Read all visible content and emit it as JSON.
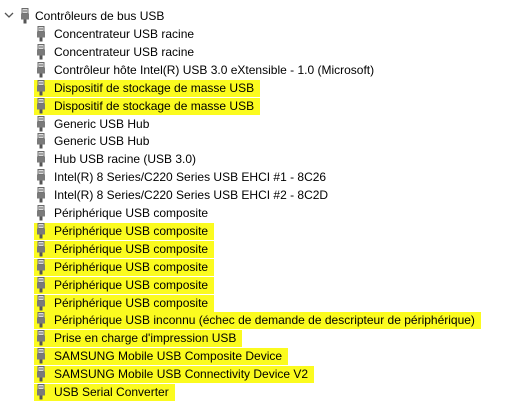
{
  "tree": {
    "category": {
      "label": "Contrôleurs de bus USB",
      "expanded": true,
      "icon": "usb-connector-icon"
    },
    "highlight_color": "#fbfb1f",
    "items": [
      {
        "label": "Concentrateur USB racine",
        "highlighted": false
      },
      {
        "label": "Concentrateur USB racine",
        "highlighted": false
      },
      {
        "label": "Contrôleur hôte Intel(R) USB 3.0 eXtensible - 1.0 (Microsoft)",
        "highlighted": false
      },
      {
        "label": "Dispositif de stockage de masse USB",
        "highlighted": true
      },
      {
        "label": "Dispositif de stockage de masse USB",
        "highlighted": true
      },
      {
        "label": "Generic USB Hub",
        "highlighted": false
      },
      {
        "label": "Generic USB Hub",
        "highlighted": false
      },
      {
        "label": "Hub USB racine (USB 3.0)",
        "highlighted": false
      },
      {
        "label": "Intel(R) 8 Series/C220 Series USB EHCI #1 - 8C26",
        "highlighted": false
      },
      {
        "label": "Intel(R) 8 Series/C220 Series USB EHCI #2 - 8C2D",
        "highlighted": false
      },
      {
        "label": "Périphérique USB composite",
        "highlighted": false
      },
      {
        "label": "Périphérique USB composite",
        "highlighted": true
      },
      {
        "label": "Périphérique USB composite",
        "highlighted": true
      },
      {
        "label": "Périphérique USB composite",
        "highlighted": true
      },
      {
        "label": "Périphérique USB composite",
        "highlighted": true
      },
      {
        "label": "Périphérique USB composite",
        "highlighted": true
      },
      {
        "label": "Périphérique USB inconnu (échec de demande de descripteur de périphérique)",
        "highlighted": true
      },
      {
        "label": "Prise en charge d'impression USB",
        "highlighted": true
      },
      {
        "label": "SAMSUNG Mobile USB Composite Device",
        "highlighted": true
      },
      {
        "label": "SAMSUNG Mobile USB Connectivity Device V2",
        "highlighted": true
      },
      {
        "label": "USB Serial Converter",
        "highlighted": true
      }
    ]
  }
}
